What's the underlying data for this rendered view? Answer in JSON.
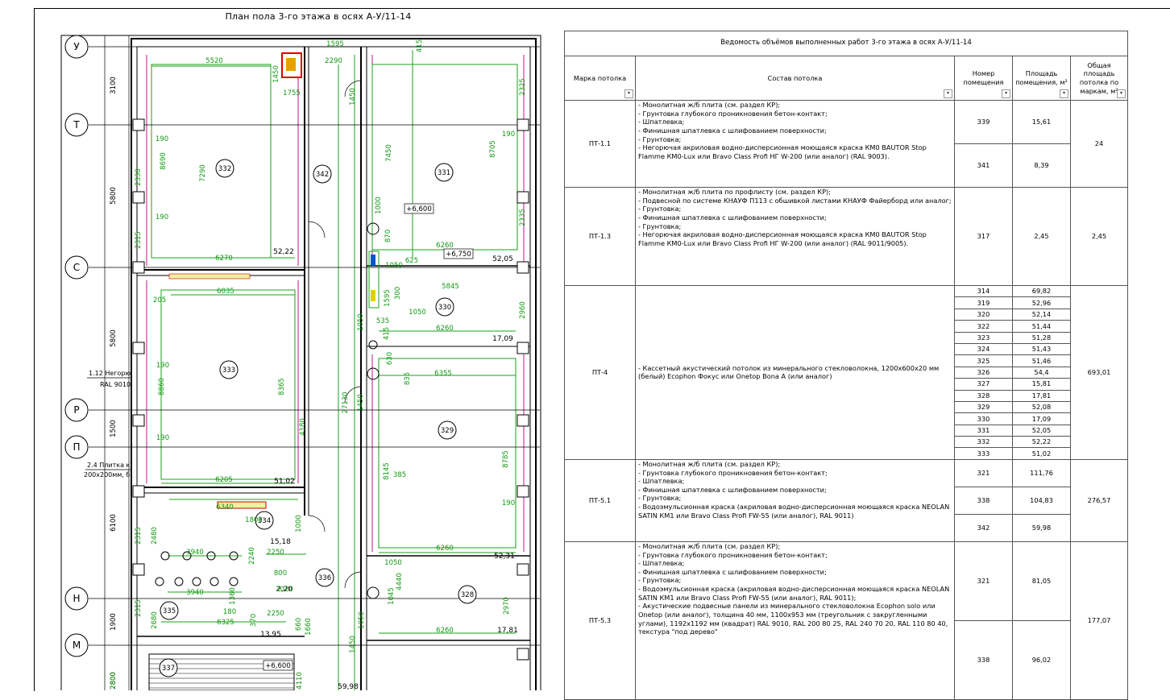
{
  "plan": {
    "title": "План пола 3-го этажа в осях А-У/11-14",
    "axes": [
      "У",
      "Т",
      "С",
      "Р",
      "П",
      "Н",
      "М"
    ],
    "axis_spacings": [
      "3100",
      "5800",
      "5800",
      "1500",
      "6100",
      "1900",
      "2800"
    ],
    "rooms": [
      {
        "id": "332",
        "area": "52,22"
      },
      {
        "id": "342",
        "area": "59,98"
      },
      {
        "id": "331",
        "area": "52,05"
      },
      {
        "id": "330",
        "area": "17,09"
      },
      {
        "id": "333",
        "area": "51,02"
      },
      {
        "id": "329",
        "area": "52,31"
      },
      {
        "id": "334",
        "area": "15,18"
      },
      {
        "id": "336",
        "area": "2,20"
      },
      {
        "id": "335",
        "area": "13,95"
      },
      {
        "id": "328",
        "area": "17,81"
      },
      {
        "id": "337",
        "area": ""
      }
    ],
    "levels": [
      "+6,600",
      "+6,750",
      "+6,600"
    ],
    "dims": [
      "5520",
      "1595",
      "2290",
      "415",
      "2325",
      "1450",
      "1755",
      "1450",
      "190",
      "8690",
      "7290",
      "7450",
      "8705",
      "190",
      "1000",
      "870",
      "625",
      "6260",
      "1050",
      "6270",
      "2335",
      "2330",
      "2315",
      "190",
      "205",
      "6035",
      "5845",
      "1050",
      "535",
      "415",
      "6260",
      "2960",
      "1595",
      "300",
      "27130",
      "1050",
      "630",
      "6355",
      "835",
      "8860",
      "8365",
      "190",
      "4180",
      "1450",
      "6205",
      "190",
      "8145",
      "385",
      "8785",
      "6340",
      "2480",
      "1800",
      "1000",
      "2315",
      "3940",
      "2240",
      "2250",
      "190",
      "6260",
      "1050",
      "2680",
      "3940",
      "1360",
      "800",
      "2020",
      "4440",
      "1045",
      "2315",
      "180",
      "370",
      "2250",
      "660",
      "1660",
      "2970",
      "6325",
      "1050",
      "6260",
      "4110",
      "2800",
      "1450"
    ],
    "notes": [
      "1.12 Негорю",
      "RAL 9010",
      "2.4 Плитка к",
      "200х200мм, б"
    ]
  },
  "schedule": {
    "title": "Ведомость объёмов выполненных работ 3-го этажа в осях А-У/11-14",
    "headers": {
      "mark": "Марка потолка",
      "composition": "Состав потолка",
      "room": "Номер помещения",
      "area": "Площадь помещения, м²",
      "total": "Общая площадь потолка по маркам, м²"
    },
    "groups": [
      {
        "mark": "ПТ-1.1",
        "composition": [
          "- Монолитная ж/б плита (см. раздел КР);",
          "- Грунтовка глубокого проникновения бетон-контакт;",
          "- Шпатлевка;",
          "- Финишная шпатлевка с шлифованием поверхности;",
          "- Грунтовка;",
          "- Негорючая акриловая водно-дисперсионная моющаяся краска КМ0 BAUTOR Stop Flamme КМ0-Lux или Bravo Class Profi НГ W-200 (или аналог) (RAL 9003)."
        ],
        "rows": [
          {
            "room": "339",
            "area": "15,61"
          },
          {
            "room": "341",
            "area": "8,39"
          }
        ],
        "total": "24"
      },
      {
        "mark": "ПТ-1.3",
        "composition": [
          "- Монолитная ж/б плита по профлисту (см. раздел КР);",
          "- Подвесной по системе КНАУФ П113 с обшивкой листами КНАУФ Файерборд или аналог;",
          "- Грунтовка;",
          "- Финишная шпатлевка с шлифованием поверхности;",
          "- Грунтовка;",
          "- Негорючая акриловая водно-дисперсионная моющаяся краска КМ0 BAUTOR Stop Flamme КМ0-Lux или Bravo Class Profi НГ W-200 (или аналог) (RAL 9011/9005)."
        ],
        "rows": [
          {
            "room": "317",
            "area": "2,45"
          }
        ],
        "total": "2,45"
      },
      {
        "mark": "ПТ-4",
        "composition": [
          "- Кассетный акустический потолок из минерального стекловолокна, 1200х600х20 мм (белый) Ecophon Фокус или Onetop Bona A (или аналог)"
        ],
        "rows": [
          {
            "room": "314",
            "area": "69,82"
          },
          {
            "room": "319",
            "area": "52,96"
          },
          {
            "room": "320",
            "area": "52,14"
          },
          {
            "room": "322",
            "area": "51,44"
          },
          {
            "room": "323",
            "area": "51,28"
          },
          {
            "room": "324",
            "area": "51,43"
          },
          {
            "room": "325",
            "area": "51,46"
          },
          {
            "room": "326",
            "area": "54,4"
          },
          {
            "room": "327",
            "area": "15,81"
          },
          {
            "room": "328",
            "area": "17,81"
          },
          {
            "room": "329",
            "area": "52,08"
          },
          {
            "room": "330",
            "area": "17,09"
          },
          {
            "room": "331",
            "area": "52,05"
          },
          {
            "room": "332",
            "area": "52,22"
          },
          {
            "room": "333",
            "area": "51,02"
          }
        ],
        "total": "693,01"
      },
      {
        "mark": "ПТ-5.1",
        "composition": [
          "- Монолитная ж/б плита (см. раздел КР);",
          "- Грунтовка глубокого проникновения бетон-контакт;",
          "- Шпатлевка;",
          "- Финишная шпатлевка с шлифованием поверхности;",
          "- Грунтовка;",
          "- Водоэмульсионная краска (акриловая водно-дисперсионная моющаяся краска NEOLAN SATIN КМ1 или Bravo Class Profi FW-55 (или аналог), RAL 9011)"
        ],
        "rows": [
          {
            "room": "321",
            "area": "111,76"
          },
          {
            "room": "338",
            "area": "104,83"
          },
          {
            "room": "342",
            "area": "59,98"
          }
        ],
        "total": "276,57"
      },
      {
        "mark": "ПТ-5.3",
        "composition": [
          "- Монолитная ж/б плита (см. раздел КР);",
          "- Грунтовка глубокого проникновения бетон-контакт;",
          "- Шпатлевка;",
          "- Финишная шпатлевка с шлифованием поверхности;",
          "- Грунтовка;",
          "- Водоэмульсионная краска (акриловая водно-дисперсионная моющаяся краска NEOLAN SATIN КМ1 или Bravo Class Profi FW-55 (или аналог), RAL 9011);",
          "- Акустические подвесные панели из минерального стекловолокна Ecophon solo или Onetop (или аналог), толщина 40 мм, 1100х953 мм (треугольник с закругленными углами), 1192х1192 мм (квадрат) RAL 9010, RAL 200 80 25, RAL 240 70 20, RAL 110 80 40, текстура \"под дерево\""
        ],
        "rows": [
          {
            "room": "321",
            "area": "81,05"
          },
          {
            "room": "338",
            "area": "96,02"
          }
        ],
        "total": "177,07"
      }
    ]
  }
}
